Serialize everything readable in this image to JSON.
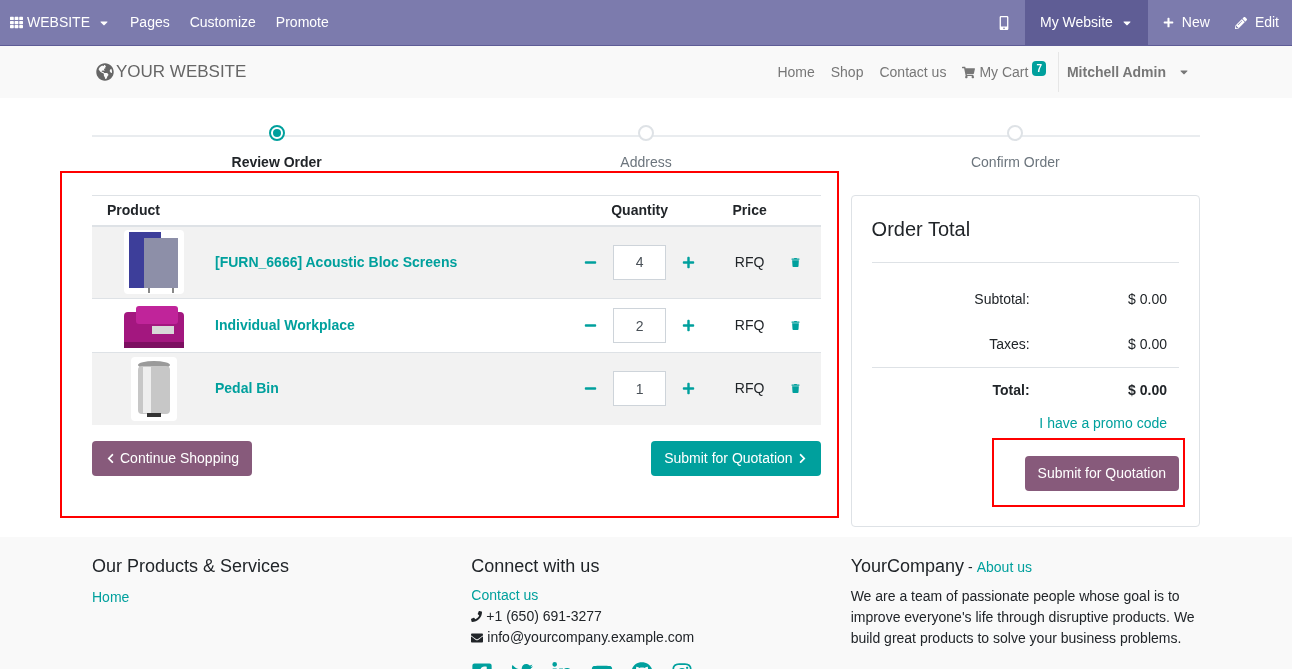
{
  "top_bar": {
    "app_menu": "WEBSITE",
    "menu": [
      "Pages",
      "Customize",
      "Promote"
    ],
    "site_switcher": "My Website",
    "new": "New",
    "edit": "Edit"
  },
  "header": {
    "logo": "YOUR WEBSITE",
    "nav": [
      {
        "label": "Home",
        "kind": "link"
      },
      {
        "label": "Shop",
        "kind": "link"
      },
      {
        "label": "Contact us",
        "kind": "link"
      },
      {
        "label": "My Cart",
        "kind": "cart",
        "badge": "7"
      }
    ],
    "user": "Mitchell Admin"
  },
  "steps": [
    {
      "label": "Review Order",
      "selected": true
    },
    {
      "label": "Address",
      "selected": false
    },
    {
      "label": "Confirm Order",
      "selected": false
    }
  ],
  "cart": {
    "columns": [
      "Product",
      "Quantity",
      "Price"
    ],
    "rows": [
      {
        "name": "[FURN_6666] Acoustic Bloc Screens",
        "quantity": "4",
        "price": "RFQ"
      },
      {
        "name": "Individual Workplace",
        "quantity": "2",
        "price": "RFQ"
      },
      {
        "name": "Pedal Bin",
        "quantity": "1",
        "price": "RFQ"
      }
    ],
    "continue": "Continue Shopping",
    "submit": "Submit for Quotation"
  },
  "order_total": {
    "title": "Order Total",
    "lines": [
      {
        "label": "Subtotal:",
        "value": "$ 0.00",
        "kind": "normal"
      },
      {
        "label": "Taxes:",
        "value": "$ 0.00",
        "kind": "normal"
      },
      {
        "label": "Total:",
        "value": "$ 0.00",
        "kind": "total"
      }
    ],
    "promo": "I have a promo code",
    "submit": "Submit for Quotation"
  },
  "footer": {
    "products": {
      "title": "Our Products & Services",
      "links": [
        "Home"
      ]
    },
    "connect": {
      "title": "Connect with us",
      "link": "Contact us",
      "phone": "+1 (650) 691-3277",
      "email": "info@yourcompany.example.com"
    },
    "company": {
      "title": "YourCompany",
      "separator": "-",
      "link": "About us",
      "paragraphs": [
        "We are a team of passionate people whose goal is to improve everyone's life through disruptive products. We build great products to solve your business problems."
      ]
    }
  }
}
